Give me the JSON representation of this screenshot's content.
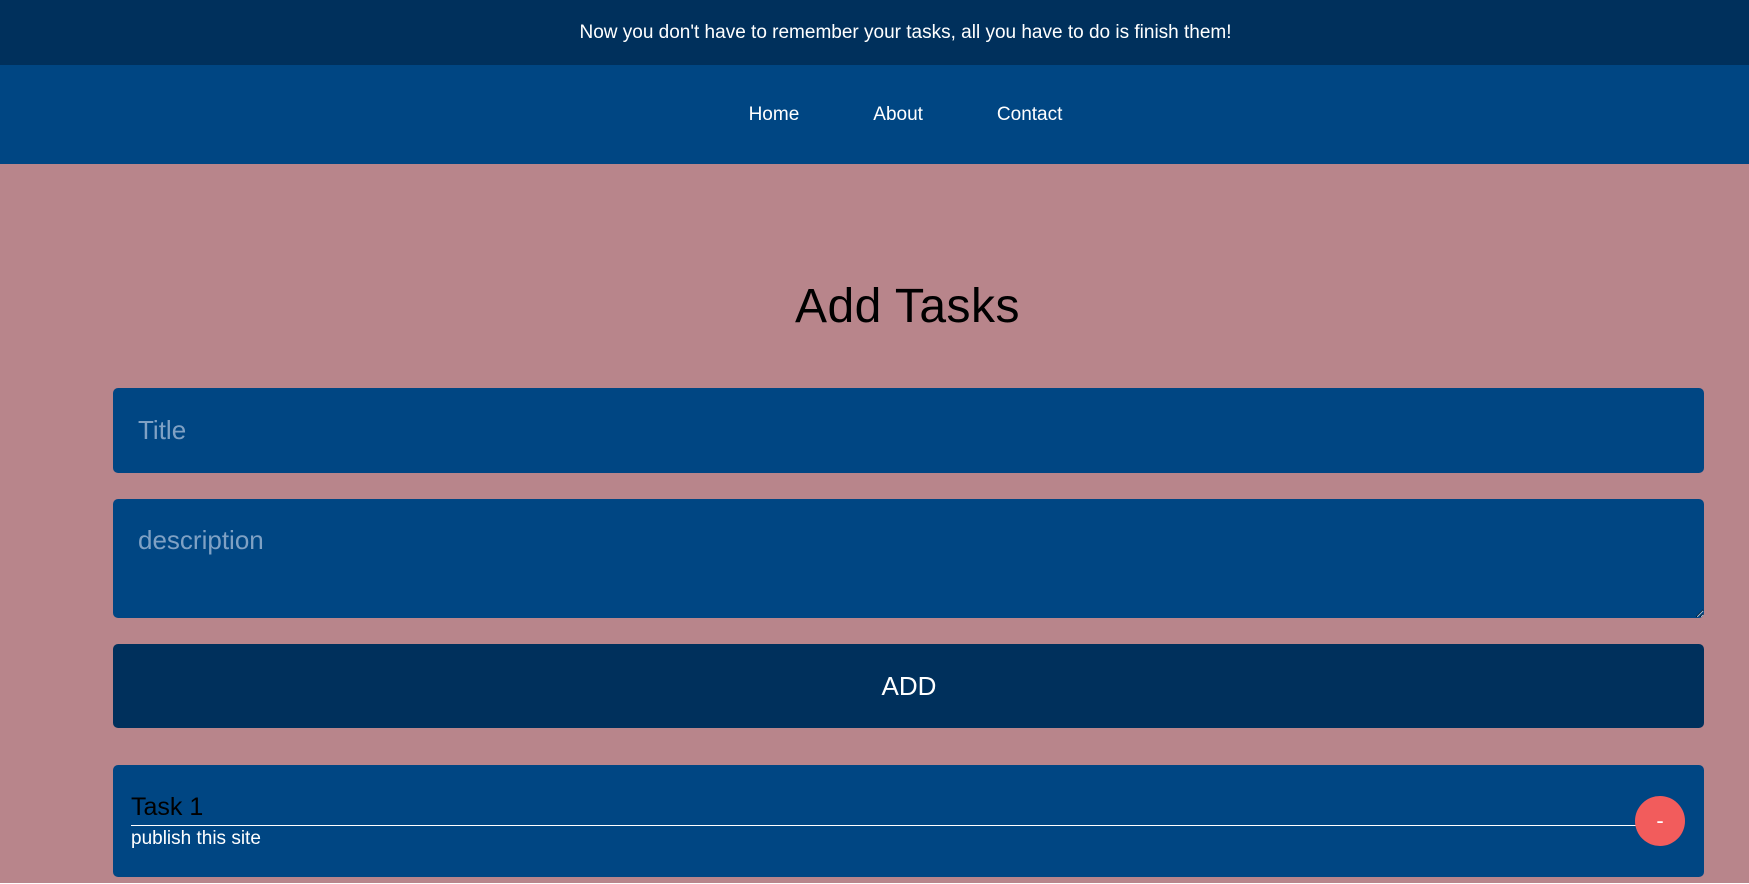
{
  "banner": {
    "text": "Now you don't have to remember your tasks, all you have to do is finish them!"
  },
  "nav": {
    "items": [
      {
        "label": "Home"
      },
      {
        "label": "About"
      },
      {
        "label": "Contact"
      }
    ]
  },
  "main": {
    "heading": "Add Tasks",
    "title_input": {
      "placeholder": "Title",
      "value": ""
    },
    "description_input": {
      "placeholder": "description",
      "value": ""
    },
    "add_button_label": "ADD",
    "tasks": [
      {
        "title": "Task 1",
        "description": "publish this site",
        "remove_label": "-"
      }
    ]
  },
  "colors": {
    "banner_bg": "#00305c",
    "nav_bg": "#004683",
    "page_bg": "#b8858b",
    "field_bg": "#004683",
    "button_bg": "#00305c",
    "remove_bg": "#f25c5c"
  }
}
